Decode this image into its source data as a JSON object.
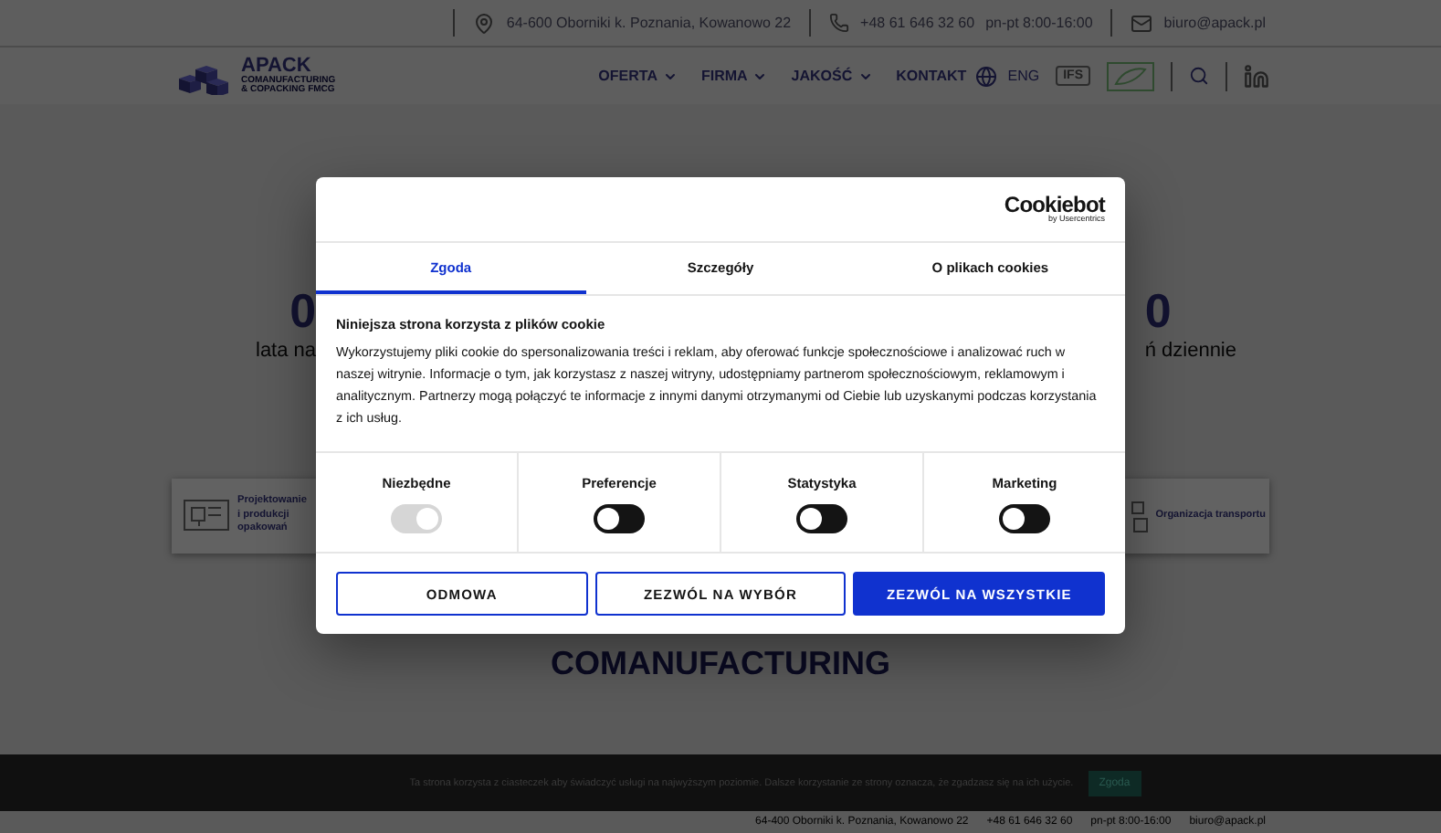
{
  "top_bar": {
    "address": "64-600 Oborniki k. Poznania, Kowanowo 22",
    "phone": "+48 61 646 32 60",
    "hours": "pn-pt 8:00-16:00",
    "email": "biuro@apack.pl"
  },
  "nav": {
    "logo": {
      "name": "APACK",
      "tagline": [
        "COMANUFACTURING",
        "& COPACKING FMCG"
      ]
    },
    "menu": [
      {
        "label": "OFERTA",
        "has_dropdown": true
      },
      {
        "label": "FIRMA",
        "has_dropdown": true
      },
      {
        "label": "JAKOŚĆ",
        "has_dropdown": true
      },
      {
        "label": "KONTAKT",
        "has_dropdown": false
      }
    ],
    "language": "ENG",
    "badge": "IFS"
  },
  "stats": [
    {
      "value": "0",
      "label": "lata na"
    },
    {
      "value": "0",
      "label": "ń dziennie"
    }
  ],
  "services": [
    {
      "label": "Projektowanie i produkcji opakowań"
    },
    {
      "label": "Organizacja transportu"
    }
  ],
  "section_heading": "COMANUFACTURING",
  "cookie_bar": {
    "text": "Ta strona korzysta z ciasteczek aby świadczyć usługi na najwyższym poziomie. Dalsze korzystanie ze strony oznacza, że zgadzasz się na ich użycie.",
    "button": "Zgoda"
  },
  "footer": {
    "address": "64-400 Oborniki k. Poznania, Kowanowo 22",
    "phone": "+48 61 646 32 60",
    "hours": "pn-pt 8:00-16:00",
    "email": "biuro@apack.pl"
  },
  "cookie_dialog": {
    "brand": "Cookiebot",
    "brand_sub": "by Usercentrics",
    "tabs": [
      {
        "label": "Zgoda",
        "selected": true
      },
      {
        "label": "Szczegóły",
        "selected": false
      },
      {
        "label": "O plikach cookies",
        "selected": false
      }
    ],
    "title": "Niniejsza strona korzysta z plików cookie",
    "text": "Wykorzystujemy pliki cookie do spersonalizowania treści i reklam, aby oferować funkcje społecznościowe i analizować ruch w naszej witrynie. Informacje o tym, jak korzystasz z naszej witryny, udostępniamy partnerom społecznościowym, reklamowym i analitycznym. Partnerzy mogą połączyć te informacje z innymi danymi otrzymanymi od Ciebie lub uzyskanymi podczas korzystania z ich usług.",
    "categories": [
      {
        "label": "Niezbędne",
        "on": true,
        "disabled": true
      },
      {
        "label": "Preferencje",
        "on": false,
        "disabled": false
      },
      {
        "label": "Statystyka",
        "on": false,
        "disabled": false
      },
      {
        "label": "Marketing",
        "on": false,
        "disabled": false
      }
    ],
    "buttons": [
      {
        "label": "ODMOWA",
        "kind": "outline"
      },
      {
        "label": "ZEZWÓL NA WYBÓR",
        "kind": "outline"
      },
      {
        "label": "ZEZWÓL NA WSZYSTKIE",
        "kind": "primary"
      }
    ]
  }
}
